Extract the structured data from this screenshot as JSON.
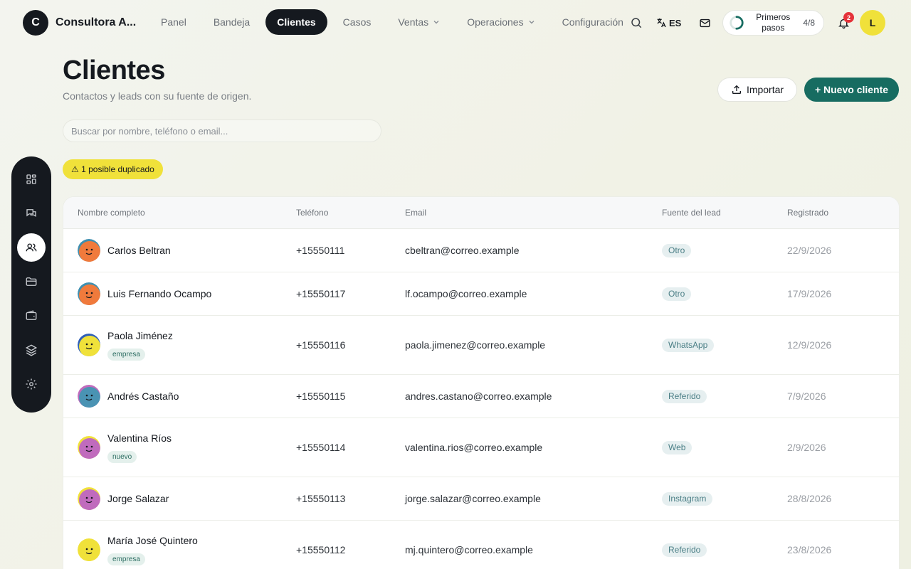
{
  "brand": {
    "initial": "C",
    "name": "Consultora A..."
  },
  "nav": {
    "items": [
      {
        "label": "Panel",
        "active": false,
        "dropdown": false
      },
      {
        "label": "Bandeja",
        "active": false,
        "dropdown": false
      },
      {
        "label": "Clientes",
        "active": true,
        "dropdown": false
      },
      {
        "label": "Casos",
        "active": false,
        "dropdown": false
      },
      {
        "label": "Ventas",
        "active": false,
        "dropdown": true
      },
      {
        "label": "Operaciones",
        "active": false,
        "dropdown": true
      },
      {
        "label": "Configuración",
        "active": false,
        "dropdown": false
      }
    ]
  },
  "topbar": {
    "language": "ES",
    "onboarding": {
      "label": "Primeros pasos",
      "count": "4/8",
      "progress": 0.5
    },
    "notifications_count": "2",
    "user_initial": "L"
  },
  "sidebar": {
    "items": [
      {
        "name": "grid-icon",
        "active": false
      },
      {
        "name": "chat-icon",
        "active": false
      },
      {
        "name": "users-icon",
        "active": true
      },
      {
        "name": "folder-icon",
        "active": false
      },
      {
        "name": "wallet-icon",
        "active": false
      },
      {
        "name": "layers-icon",
        "active": false
      },
      {
        "name": "gear-icon",
        "active": false
      }
    ]
  },
  "page": {
    "title": "Clientes",
    "subtitle": "Contactos y leads con su fuente de origen.",
    "import_label": "Importar",
    "new_label": "+ Nuevo cliente",
    "search_placeholder": "Buscar por nombre, teléfono o email...",
    "duplicate_notice": "⚠ 1 posible duplicado"
  },
  "table": {
    "columns": [
      "Nombre completo",
      "Teléfono",
      "Email",
      "Fuente del lead",
      "Registrado"
    ],
    "rows": [
      {
        "name": "Carlos Beltran",
        "tag": "",
        "phone": "+15550111",
        "email": "cbeltran@correo.example",
        "source": "Otro",
        "registered": "22/9/2026",
        "avatar_bg": "#f07a3c",
        "avatar_accent": "#3f8fb0"
      },
      {
        "name": "Luis Fernando Ocampo",
        "tag": "",
        "phone": "+15550117",
        "email": "lf.ocampo@correo.example",
        "source": "Otro",
        "registered": "17/9/2026",
        "avatar_bg": "#f07a3c",
        "avatar_accent": "#3f8fb0"
      },
      {
        "name": "Paola Jiménez",
        "tag": "empresa",
        "phone": "+15550116",
        "email": "paola.jimenez@correo.example",
        "source": "WhatsApp",
        "registered": "12/9/2026",
        "avatar_bg": "#f0e13a",
        "avatar_accent": "#2f5fb8"
      },
      {
        "name": "Andrés Castaño",
        "tag": "",
        "phone": "+15550115",
        "email": "andres.castano@correo.example",
        "source": "Referido",
        "registered": "7/9/2026",
        "avatar_bg": "#4a93b3",
        "avatar_accent": "#c06bbd"
      },
      {
        "name": "Valentina Ríos",
        "tag": "nuevo",
        "phone": "+15550114",
        "email": "valentina.rios@correo.example",
        "source": "Web",
        "registered": "2/9/2026",
        "avatar_bg": "#c06bbd",
        "avatar_accent": "#f0e13a"
      },
      {
        "name": "Jorge Salazar",
        "tag": "",
        "phone": "+15550113",
        "email": "jorge.salazar@correo.example",
        "source": "Instagram",
        "registered": "28/8/2026",
        "avatar_bg": "#c06bbd",
        "avatar_accent": "#f0e13a"
      },
      {
        "name": "María José Quintero",
        "tag": "empresa",
        "phone": "+15550112",
        "email": "mj.quintero@correo.example",
        "source": "Referido",
        "registered": "23/8/2026",
        "avatar_bg": "#f0e13a",
        "avatar_accent": "#f0e13a"
      }
    ]
  },
  "colors": {
    "dark": "#15191f",
    "primary": "#176c61",
    "highlight": "#f0e13a",
    "danger": "#e5333a",
    "tag_bg": "#e4f0ec",
    "source_bg": "#e6eff0"
  }
}
